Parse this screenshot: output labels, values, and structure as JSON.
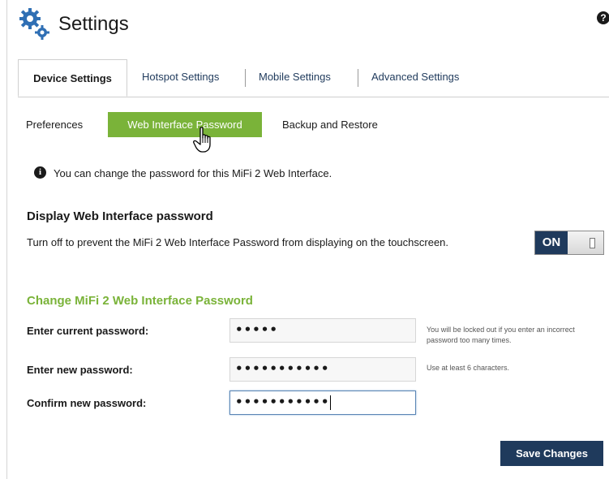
{
  "header": {
    "title": "Settings",
    "help_glyph": "?"
  },
  "tabs": [
    {
      "label": "Device Settings",
      "active": true
    },
    {
      "label": "Hotspot Settings",
      "active": false
    },
    {
      "label": "Mobile Settings",
      "active": false
    },
    {
      "label": "Advanced Settings",
      "active": false
    }
  ],
  "subtabs": [
    {
      "label": "Preferences",
      "active": false
    },
    {
      "label": "Web Interface Password",
      "active": true
    },
    {
      "label": "Backup and Restore",
      "active": false
    }
  ],
  "info": {
    "glyph": "i",
    "text": "You can change the password for this MiFi 2 Web Interface."
  },
  "display_password": {
    "heading": "Display Web Interface password",
    "description": "Turn off to prevent the MiFi 2 Web Interface Password from displaying on the touchscreen.",
    "toggle_label": "ON",
    "toggle_state": "on"
  },
  "change_password": {
    "heading": "Change MiFi 2 Web Interface Password",
    "fields": [
      {
        "label": "Enter current password:",
        "value": "•••••",
        "hint": "You will be locked out if you enter an incorrect password too many times."
      },
      {
        "label": "Enter new password:",
        "value": "•••••••••••",
        "hint": "Use at least 6 characters."
      },
      {
        "label": "Confirm new password:",
        "value": "•••••••••••",
        "hint": ""
      }
    ]
  },
  "save_label": "Save Changes",
  "colors": {
    "accent_green": "#7ab339",
    "navy": "#1f3a5c",
    "link": "#1f3a5c"
  },
  "icons": {
    "title": "gears-icon",
    "help": "help-icon",
    "info": "info-icon",
    "cursor": "hand-cursor-icon"
  }
}
